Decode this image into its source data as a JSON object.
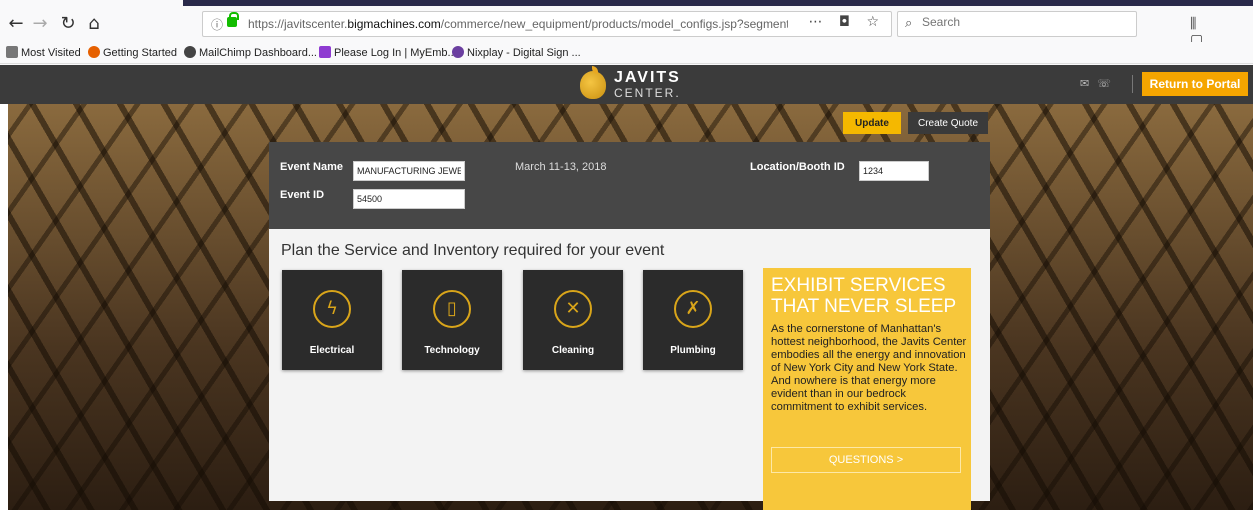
{
  "browser": {
    "url_domain_prefix": "https://javitscenter.",
    "url_domain_bold": "bigmachines.com",
    "url_path": "/commerce/new_equipment/products/model_configs.jsp?segment=se",
    "search_placeholder": "Search",
    "bookmarks": [
      {
        "label": "Most Visited",
        "color": "#777777"
      },
      {
        "label": "Getting Started",
        "color": "#e66000"
      },
      {
        "label": "MailChimp Dashboard...",
        "color": "#444444"
      },
      {
        "label": "Please Log In | MyEmb...",
        "color": "#8e3bd1"
      },
      {
        "label": "Nixplay - Digital Sign ...",
        "color": "#6b3fa0"
      }
    ]
  },
  "site": {
    "brand_line1": "JAVITS",
    "brand_line2": "CENTER.",
    "return_label": "Return to Portal"
  },
  "actions": {
    "update_label": "Update",
    "create_quote_label": "Create Quote"
  },
  "event": {
    "name_label": "Event Name",
    "name_value": "MANUFACTURING JEWELI",
    "id_label": "Event ID",
    "id_value": "54500",
    "date": "March 11-13, 2018",
    "location_label": "Location/Booth ID",
    "location_value": "1234"
  },
  "plan": {
    "title": "Plan the Service and Inventory required for your event",
    "tiles": [
      {
        "label": "Electrical",
        "icon": "lightning-icon"
      },
      {
        "label": "Technology",
        "icon": "phone-icon"
      },
      {
        "label": "Cleaning",
        "icon": "brooms-icon"
      },
      {
        "label": "Plumbing",
        "icon": "wrenches-icon"
      }
    ]
  },
  "promo": {
    "heading": "EXHIBIT SERVICES THAT NEVER SLEEP",
    "text": "As the cornerstone of Manhattan's hottest neighborhood, the Javits Center embodies all the energy and innovation of New York City and New York State. And nowhere is that energy more evident than in our bedrock commitment to exhibit services.",
    "button_label": "QUESTIONS >"
  },
  "colors": {
    "accent": "#f5a500",
    "promo_bg": "#f7c73b",
    "tile_bg": "#2b2b2b"
  }
}
